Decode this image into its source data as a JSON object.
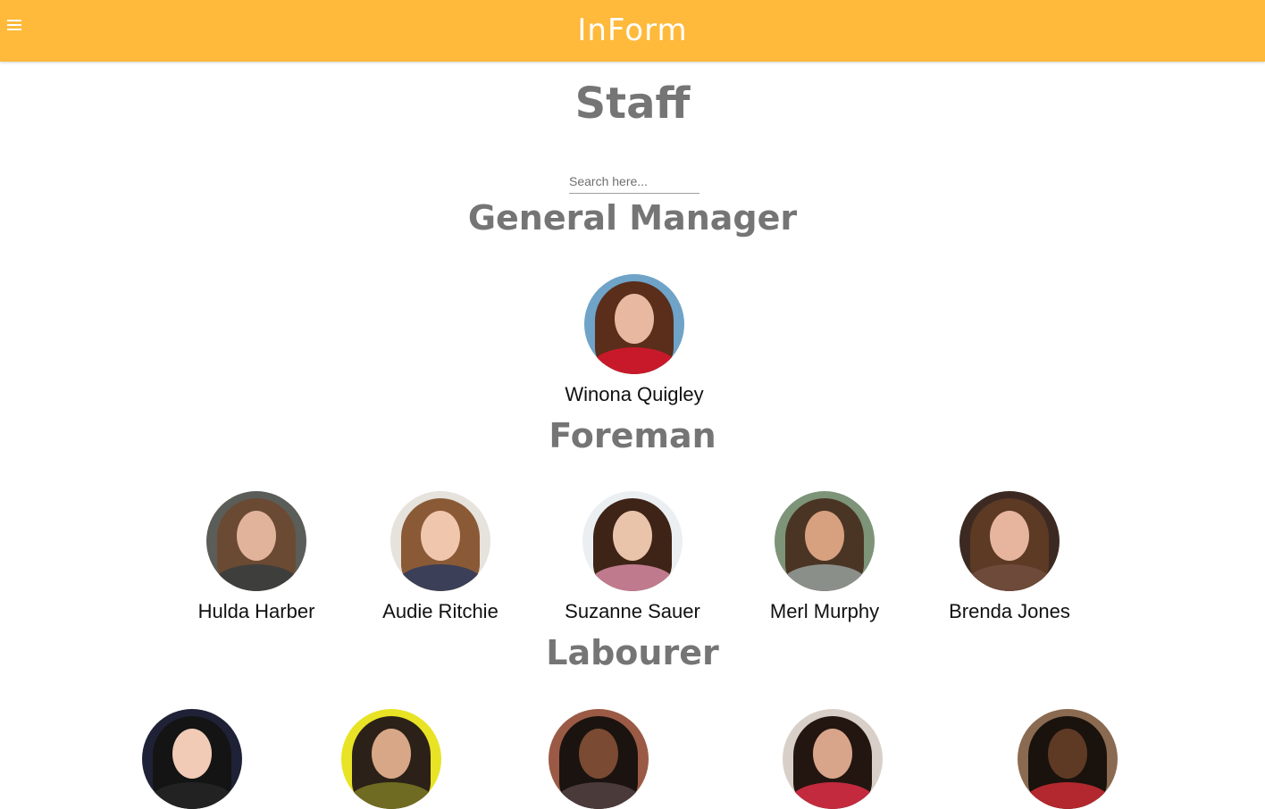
{
  "app": {
    "title": "InForm",
    "accent_color": "#ffb93b",
    "menu_icon": "hamburger-menu-icon"
  },
  "page": {
    "title": "Staff"
  },
  "search": {
    "placeholder": "Search here...",
    "value": ""
  },
  "sections": [
    {
      "title": "General Manager",
      "people": [
        {
          "name": "Winona Quigley",
          "bg": "#6fa3c8",
          "hair": "#5a2e1a",
          "skin": "#e8b9a0",
          "shirt": "#c8192b"
        }
      ]
    },
    {
      "title": "Foreman",
      "people": [
        {
          "name": "Hulda Harber",
          "bg": "#5b5d58",
          "hair": "#6b4a33",
          "skin": "#e1b39a",
          "shirt": "#3e3f3c"
        },
        {
          "name": "Audie Ritchie",
          "bg": "#e6e2dc",
          "hair": "#8a5a36",
          "skin": "#f0c7ad",
          "shirt": "#3b3f57"
        },
        {
          "name": "Suzanne Sauer",
          "bg": "#eceff2",
          "hair": "#3d2416",
          "skin": "#eac3ab",
          "shirt": "#c07a8e"
        },
        {
          "name": "Merl Murphy",
          "bg": "#7d9478",
          "hair": "#4a3525",
          "skin": "#d7a07f",
          "shirt": "#8b8f8a"
        },
        {
          "name": "Brenda Jones",
          "bg": "#3c2a22",
          "hair": "#5c3a24",
          "skin": "#e7b59e",
          "shirt": "#6e4a3a"
        }
      ]
    },
    {
      "title": "Labourer",
      "people": [
        {
          "name": "",
          "bg": "#1f2236",
          "hair": "#141414",
          "skin": "#f1cbb6",
          "shirt": "#222222"
        },
        {
          "name": "",
          "bg": "#e8e324",
          "hair": "#2c2118",
          "skin": "#d8a787",
          "shirt": "#6f6b22"
        },
        {
          "name": "",
          "bg": "#9b5a45",
          "hair": "#1b130f",
          "skin": "#7a4a32",
          "shirt": "#4a3a3a"
        },
        {
          "name": "",
          "bg": "#d8d0c8",
          "hair": "#231611",
          "skin": "#d9a58a",
          "shirt": "#c42a3e"
        },
        {
          "name": "",
          "bg": "#8a6a50",
          "hair": "#1a120d",
          "skin": "#5e3a25",
          "shirt": "#b2282e"
        }
      ]
    }
  ]
}
